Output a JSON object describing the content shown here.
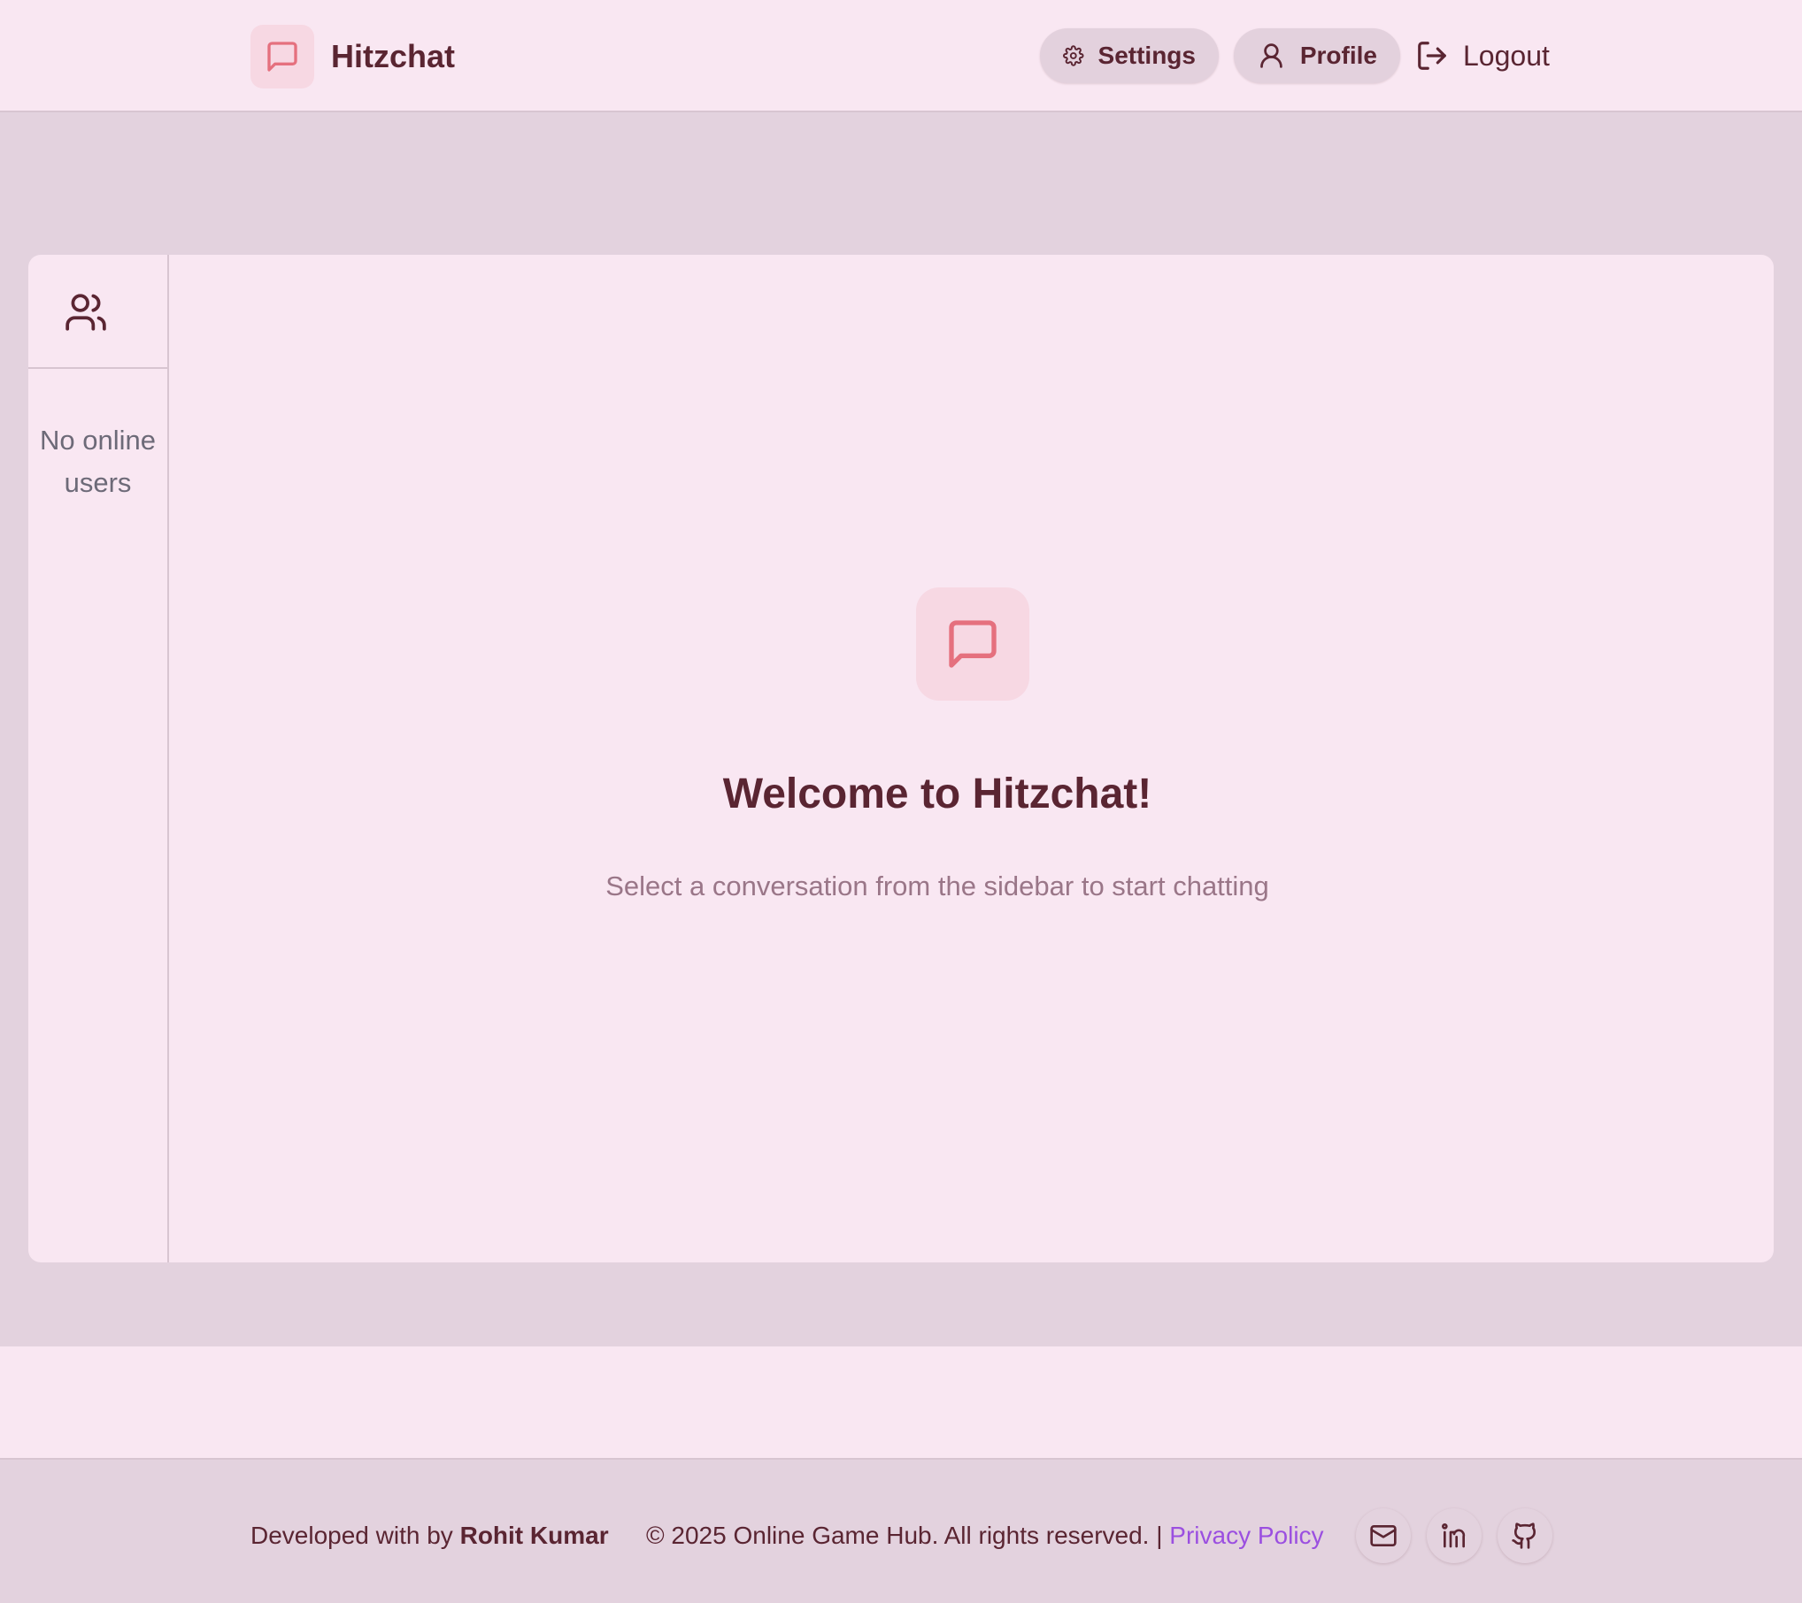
{
  "colors": {
    "page_background": "#e3d2de",
    "surface": "#f9e7f2",
    "accent": "#e5707e",
    "accent_tint": "#f7d8e3",
    "text_primary": "#5a2532",
    "text_muted": "#9a7688",
    "link": "#9b4fe0"
  },
  "header": {
    "app_name": "Hitzchat",
    "logo_icon": "message-square-icon",
    "nav": {
      "settings_label": "Settings",
      "settings_icon": "gear-icon",
      "profile_label": "Profile",
      "profile_icon": "user-icon",
      "logout_label": "Logout",
      "logout_icon": "logout-icon"
    }
  },
  "sidebar": {
    "header_icon": "users-icon",
    "empty_text": "No online users"
  },
  "welcome": {
    "icon": "message-square-icon",
    "title": "Welcome to Hitzchat!",
    "subtitle": "Select a conversation from the sidebar to start chatting"
  },
  "footer": {
    "developed_prefix": "Developed with by",
    "developer_name": "Rohit Kumar",
    "copyright": "© 2025 Online Game Hub. All rights reserved. |",
    "privacy_link": "Privacy Policy",
    "social_icons": [
      "mail-icon",
      "linkedin-icon",
      "github-icon"
    ]
  }
}
